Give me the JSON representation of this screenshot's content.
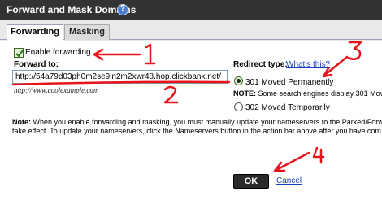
{
  "dialog": {
    "title": "Forward and Mask Domains",
    "help_icon": "question-icon"
  },
  "tabs": [
    {
      "label": "Forwarding",
      "active": true
    },
    {
      "label": "Masking",
      "active": false
    }
  ],
  "forwarding": {
    "enable_label": "Enable forwarding",
    "enable_checked": true,
    "forward_to_label": "Forward to:",
    "forward_to_value": "http://54a79d03ph0m2se9jn2m2xwr48.hop.clickbank.net/",
    "example_text": "http://www.coolexample.com"
  },
  "redirect": {
    "label": "Redirect type:",
    "whats_this": "What's this?",
    "options": [
      {
        "label": "301 Moved Permanently",
        "selected": true
      },
      {
        "label": "302 Moved Temporarily",
        "selected": false
      }
    ],
    "note_label": "NOTE:",
    "note_text": " Some search engines display 301 Move"
  },
  "note": {
    "label": "Note:",
    "line1": " When you enable forwarding and masking, you must manually update your nameservers to the Parked/Forw",
    "line2": "take effect. To update your nameservers, click the Nameservers button in the action bar above after you have com"
  },
  "buttons": {
    "ok": "OK",
    "cancel": "Cancel"
  },
  "annotations": {
    "numbers": [
      "1",
      "2",
      "3",
      "4"
    ],
    "color": "#e8141c"
  },
  "colors": {
    "titlebar": "#333333",
    "link": "#1a3fbf",
    "annotation": "#e8141c"
  }
}
